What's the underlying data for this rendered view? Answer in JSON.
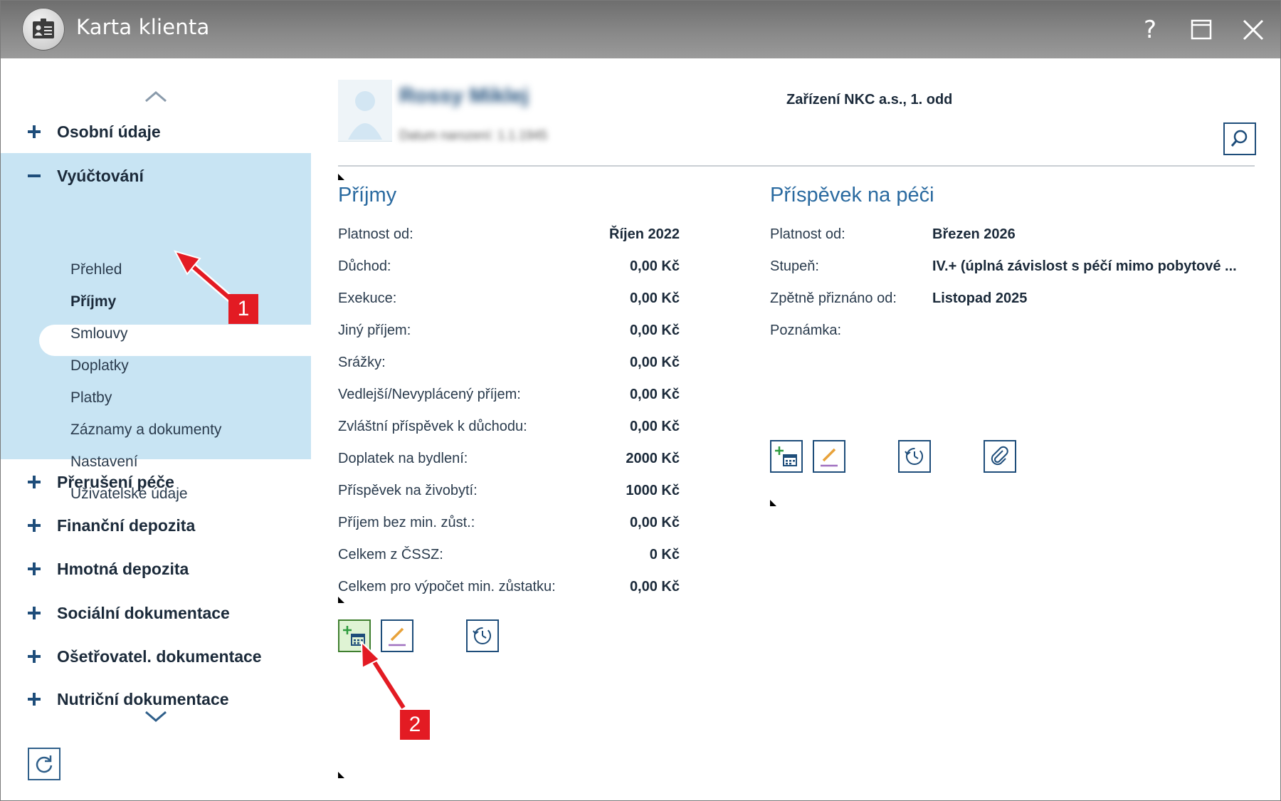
{
  "window": {
    "title": "Karta klienta",
    "help_label": "?"
  },
  "sidebar": {
    "groups": [
      {
        "label": "Osobní údaje",
        "expanded": false
      },
      {
        "label": "Vyúčtování",
        "expanded": true,
        "items": [
          {
            "label": "Přehled"
          },
          {
            "label": "Příjmy",
            "selected": true
          },
          {
            "label": "Smlouvy"
          },
          {
            "label": "Doplatky"
          },
          {
            "label": "Platby"
          },
          {
            "label": "Záznamy a dokumenty"
          },
          {
            "label": "Nastavení"
          },
          {
            "label": "Uživatelské údaje"
          }
        ]
      },
      {
        "label": "Přerušení péče",
        "expanded": false
      },
      {
        "label": "Finanční depozita",
        "expanded": false
      },
      {
        "label": "Hmotná depozita",
        "expanded": false
      },
      {
        "label": "Sociální dokumentace",
        "expanded": false
      },
      {
        "label": "Ošetřovatel. dokumentace",
        "expanded": false
      },
      {
        "label": "Nutriční dokumentace",
        "expanded": false
      }
    ]
  },
  "header": {
    "client_name": "Rossy Miklej",
    "client_subtitle": "Datum narození: 1.1.1945",
    "facility": "Zařízení NKC a.s., 1. odd"
  },
  "prijmy": {
    "title": "Příjmy",
    "rows": [
      {
        "label": "Platnost od:",
        "value": "Říjen 2022"
      },
      {
        "label": "Důchod:",
        "value": "0,00 Kč"
      },
      {
        "label": "Exekuce:",
        "value": "0,00 Kč"
      },
      {
        "label": "Jiný příjem:",
        "value": "0,00 Kč"
      },
      {
        "label": "Srážky:",
        "value": "0,00 Kč"
      },
      {
        "label": "Vedlejší/Nevyplácený příjem:",
        "value": "0,00 Kč"
      },
      {
        "label": "Zvláštní příspěvek k důchodu:",
        "value": "0,00 Kč"
      },
      {
        "label": "Doplatek na bydlení:",
        "value": "2000 Kč"
      },
      {
        "label": "Příspěvek na živobytí:",
        "value": "1000 Kč"
      },
      {
        "label": "Příjem bez min. zůst.:",
        "value": "0,00 Kč"
      },
      {
        "label": "Celkem z ČSSZ:",
        "value": "0 Kč"
      },
      {
        "label": "Celkem pro výpočet min. zůstatku:",
        "value": "0,00 Kč"
      }
    ]
  },
  "prispevek": {
    "title": "Příspěvek na péči",
    "rows": [
      {
        "label": "Platnost od:",
        "value": "Březen 2026"
      },
      {
        "label": "Stupeň:",
        "value": "IV.+ (úplná závislost s péčí mimo pobytové ..."
      },
      {
        "label": "Zpětně přiznáno od:",
        "value": "Listopad 2025"
      },
      {
        "label": "Poznámka:",
        "value": ""
      }
    ]
  },
  "annotations": {
    "badge_1": "1",
    "badge_2": "2",
    "color": "#e31b23"
  },
  "colors": {
    "accent": "#2a6aa0",
    "sidebar_highlight": "#c8e4f3"
  }
}
